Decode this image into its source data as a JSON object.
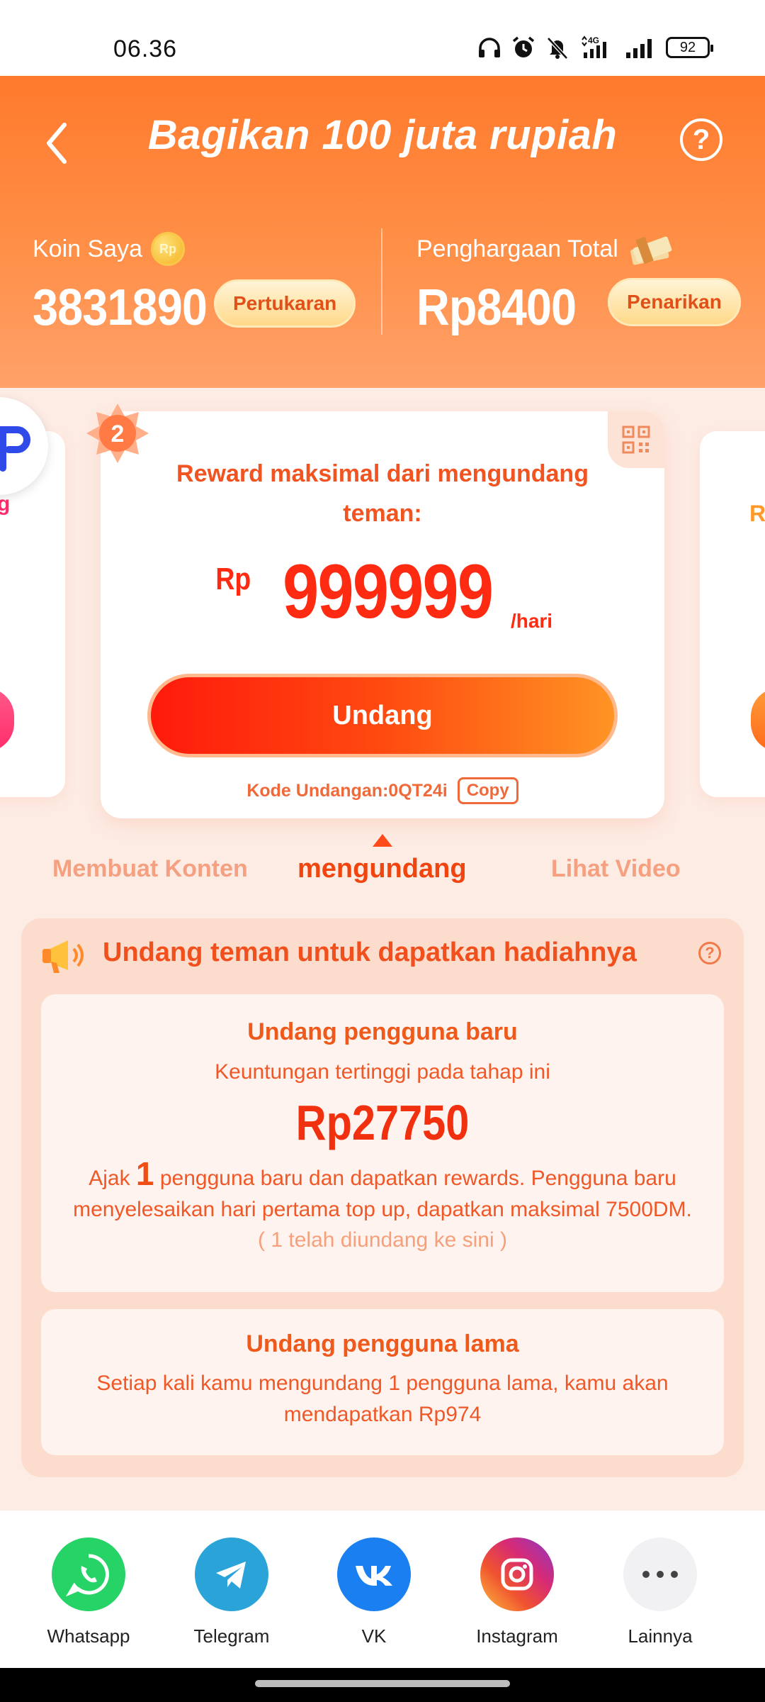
{
  "status_bar": {
    "time": "06.36",
    "battery": "92"
  },
  "header": {
    "title": "Bagikan 100 juta rupiah",
    "coins": {
      "label": "Koin Saya",
      "coin_icon_text": "Rp",
      "value": "3831890",
      "button": "Pertukaran"
    },
    "reward": {
      "label": "Penghargaan Total",
      "value": "Rp8400",
      "button": "Penarikan"
    }
  },
  "carousel": {
    "badge_number": "2",
    "heading": "Reward maksimal dari mengundang teman:",
    "currency": "Rp",
    "amount": "999999",
    "unit": "/hari",
    "invite_button": "Undang",
    "invite_code_label": "Kode Undangan:0QT24i",
    "copy_button": "Copy",
    "left_peek_text": "g",
    "right_peek_text": "Re"
  },
  "tabs": [
    {
      "label": "Membuat Konten",
      "active": false
    },
    {
      "label": "mengundang",
      "active": true
    },
    {
      "label": "Lihat Video",
      "active": false
    }
  ],
  "panel": {
    "title": "Undang teman untuk dapatkan hadiahnya",
    "new_users": {
      "title": "Undang pengguna baru",
      "subtitle": "Keuntungan tertinggi pada tahap ini",
      "amount": "Rp27750",
      "line1_prefix": "Ajak",
      "line1_count": "1",
      "line1_suffix": "pengguna baru dan dapatkan rewards. Pengguna baru",
      "line2": "menyelesaikan hari pertama top up, dapatkan maksimal 7500DM.",
      "invited_status": "( 1 telah diundang ke sini )"
    },
    "old_users": {
      "title": "Undang pengguna lama",
      "line1": "Setiap kali kamu mengundang 1 pengguna lama, kamu akan",
      "line2": "mendapatkan Rp974"
    }
  },
  "share": [
    {
      "label": "Whatsapp",
      "icon": "whatsapp-icon",
      "color": "#25d366"
    },
    {
      "label": "Telegram",
      "icon": "telegram-icon",
      "color": "#2aa3d8"
    },
    {
      "label": "VK",
      "icon": "vk-icon",
      "color": "#1a7ff0"
    },
    {
      "label": "Instagram",
      "icon": "instagram-icon",
      "color": "#e1306c"
    },
    {
      "label": "Lainnya",
      "icon": "more-icon",
      "color": "#f1f1f4"
    }
  ],
  "colors": {
    "accent": "#ff7a2c",
    "reward_red": "#ff2a12",
    "text_orange": "#f1501c"
  }
}
